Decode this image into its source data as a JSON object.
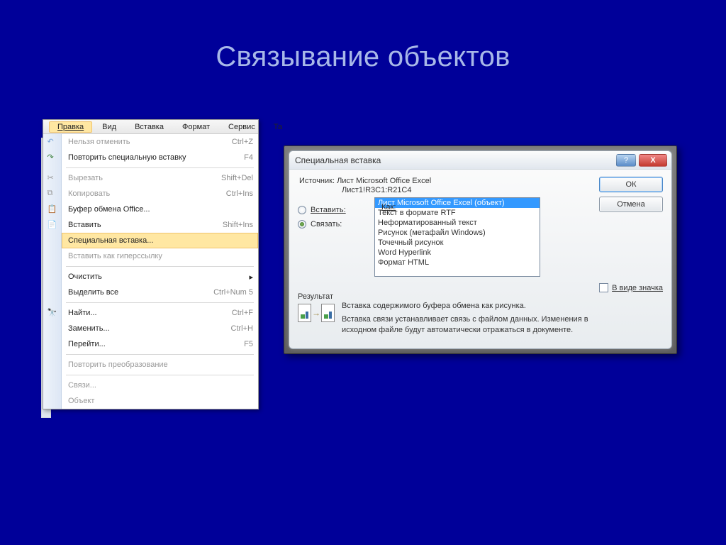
{
  "slide": {
    "title": "Связывание объектов"
  },
  "menubar": {
    "items": [
      {
        "label": "Правка",
        "current": true
      },
      {
        "label": "Вид"
      },
      {
        "label": "Вставка"
      },
      {
        "label": "Формат"
      },
      {
        "label": "Сервис"
      },
      {
        "label": "Та"
      }
    ]
  },
  "menu_items": [
    {
      "label": "Нельзя отменить",
      "shortcut": "Ctrl+Z",
      "disabled": true,
      "icon": "undo"
    },
    {
      "label": "Повторить специальную вставку",
      "shortcut": "F4",
      "icon": "redo"
    },
    {
      "sep": true
    },
    {
      "label": "Вырезать",
      "shortcut": "Shift+Del",
      "disabled": true,
      "icon": "cut"
    },
    {
      "label": "Копировать",
      "shortcut": "Ctrl+Ins",
      "disabled": true,
      "icon": "copy"
    },
    {
      "label": "Буфер обмена Office...",
      "icon": "clipboard"
    },
    {
      "label": "Вставить",
      "shortcut": "Shift+Ins",
      "icon": "paste"
    },
    {
      "label": "Специальная вставка...",
      "highlight": true
    },
    {
      "label": "Вставить как гиперссылку",
      "disabled": true
    },
    {
      "sep": true
    },
    {
      "label": "Очистить",
      "submenu": true
    },
    {
      "label": "Выделить все",
      "shortcut": "Ctrl+Num 5"
    },
    {
      "sep": true
    },
    {
      "label": "Найти...",
      "shortcut": "Ctrl+F",
      "icon": "find"
    },
    {
      "label": "Заменить...",
      "shortcut": "Ctrl+H"
    },
    {
      "label": "Перейти...",
      "shortcut": "F5"
    },
    {
      "sep": true
    },
    {
      "label": "Повторить преобразование",
      "disabled": true
    },
    {
      "sep": true
    },
    {
      "label": "Связи...",
      "disabled": true
    },
    {
      "label": "Объект",
      "disabled": true
    }
  ],
  "dialog": {
    "title": "Специальная вставка",
    "source1": "Источник: Лист Microsoft Office Excel",
    "source2": "Лист1!R3C1:R21C4",
    "kak": "Как:",
    "radio_insert": "Вставить:",
    "radio_link": "Связать:",
    "ok": "ОК",
    "cancel": "Отмена",
    "as_icon": "В виде значка",
    "result_label": "Результат",
    "result_p1": "Вставка содержимого буфера обмена как рисунка.",
    "result_p2": "Вставка связи устанавливает связь с файлом данных. Изменения в исходном файле будут автоматически отражаться в документе."
  },
  "list_options": [
    "Лист Microsoft Office Excel (объект)",
    "Текст в формате RTF",
    "Неформатированный текст",
    "Рисунок (метафайл Windows)",
    "Точечный рисунок",
    "Word Hyperlink",
    "Формат HTML"
  ]
}
